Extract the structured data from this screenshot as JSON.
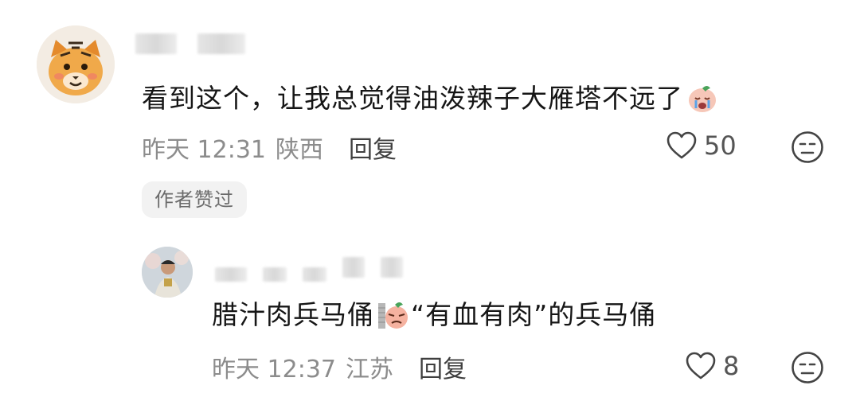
{
  "comments": [
    {
      "text": "看到这个，让我总觉得油泼辣子大雁塔不远了",
      "emoji_icon": "crying-face-emoji",
      "time": "昨天 12:31",
      "location": "陕西",
      "reply_label": "回复",
      "likes": "50",
      "badge": "作者赞过"
    }
  ],
  "reply": {
    "text_before": "腊汁肉兵马俑",
    "emoji_icon": "grumpy-face-emoji",
    "text_after": "“有血有肉”的兵马俑",
    "time": "昨天 12:37",
    "location": "江苏",
    "reply_label": "回复",
    "likes": "8"
  },
  "icons": {
    "like": "heart-outline-icon",
    "dislike": "meh-face-icon",
    "accent_text": "#161616",
    "meta_text": "#8c8c8c"
  }
}
